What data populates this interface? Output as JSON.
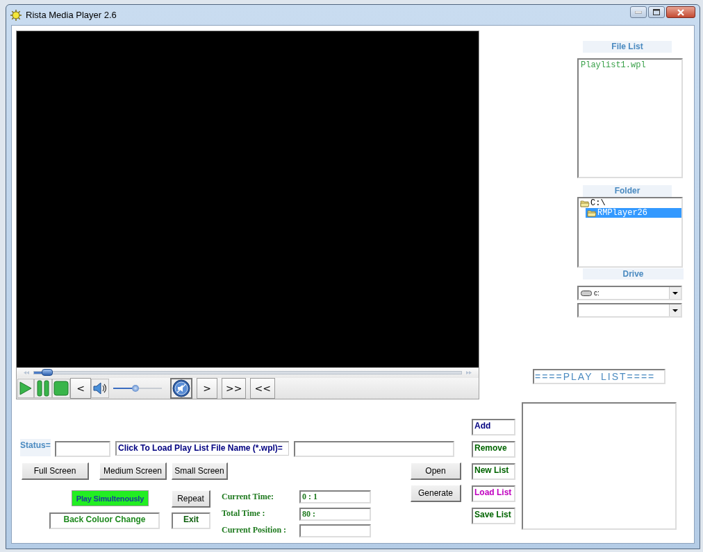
{
  "window": {
    "title": "Rista Media Player 2.6"
  },
  "player": {
    "seek": {
      "level": 0.03
    },
    "volume": {
      "level": 0.45
    },
    "controls": [
      {
        "kind": "play"
      },
      {
        "kind": "pause"
      },
      {
        "kind": "stop"
      },
      {
        "kind": "text",
        "label": "<"
      },
      {
        "kind": "speaker"
      },
      {
        "kind": "volume"
      },
      {
        "kind": "mute"
      },
      {
        "kind": "text",
        "label": ">"
      },
      {
        "kind": "text",
        "label": ">>"
      },
      {
        "kind": "text",
        "label": "<<"
      }
    ]
  },
  "file_list": {
    "label": "File List",
    "items": [
      "Playlist1.wpl"
    ]
  },
  "folder": {
    "label": "Folder",
    "items": [
      {
        "name": "C:\\",
        "selected": false,
        "children": [
          {
            "name": "RMPlayer26",
            "selected": true
          }
        ]
      }
    ]
  },
  "drive": {
    "label": "Drive",
    "value": "c:"
  },
  "playlist": {
    "title": "====PLAY  LIST===="
  },
  "list_buttons": [
    {
      "label": "Add",
      "color": "#000080"
    },
    {
      "label": "Remove",
      "color": "#006400"
    },
    {
      "label": "New List",
      "color": "#006400"
    },
    {
      "label": "Load List",
      "color": "#c000c0"
    },
    {
      "label": "Save List",
      "color": "#006400"
    }
  ],
  "status": {
    "label": "Status="
  },
  "load_label": "Click To Load Play List File Name (*.wpl)=",
  "screen_buttons": [
    "Full Screen",
    "Medium Screen",
    "Small Screen"
  ],
  "file_buttons": [
    "Open",
    "Generate"
  ],
  "play_simultaneously": {
    "label": "Play Simultenously",
    "on": true
  },
  "repeat": "Repeat",
  "exit": "Exit",
  "back_colour": "Back Coluor Change",
  "times": [
    {
      "label": "Current Time:",
      "value": "0 : 1"
    },
    {
      "label": "Total Time :",
      "value": "80 :"
    },
    {
      "label": "Current Position :"
    }
  ]
}
